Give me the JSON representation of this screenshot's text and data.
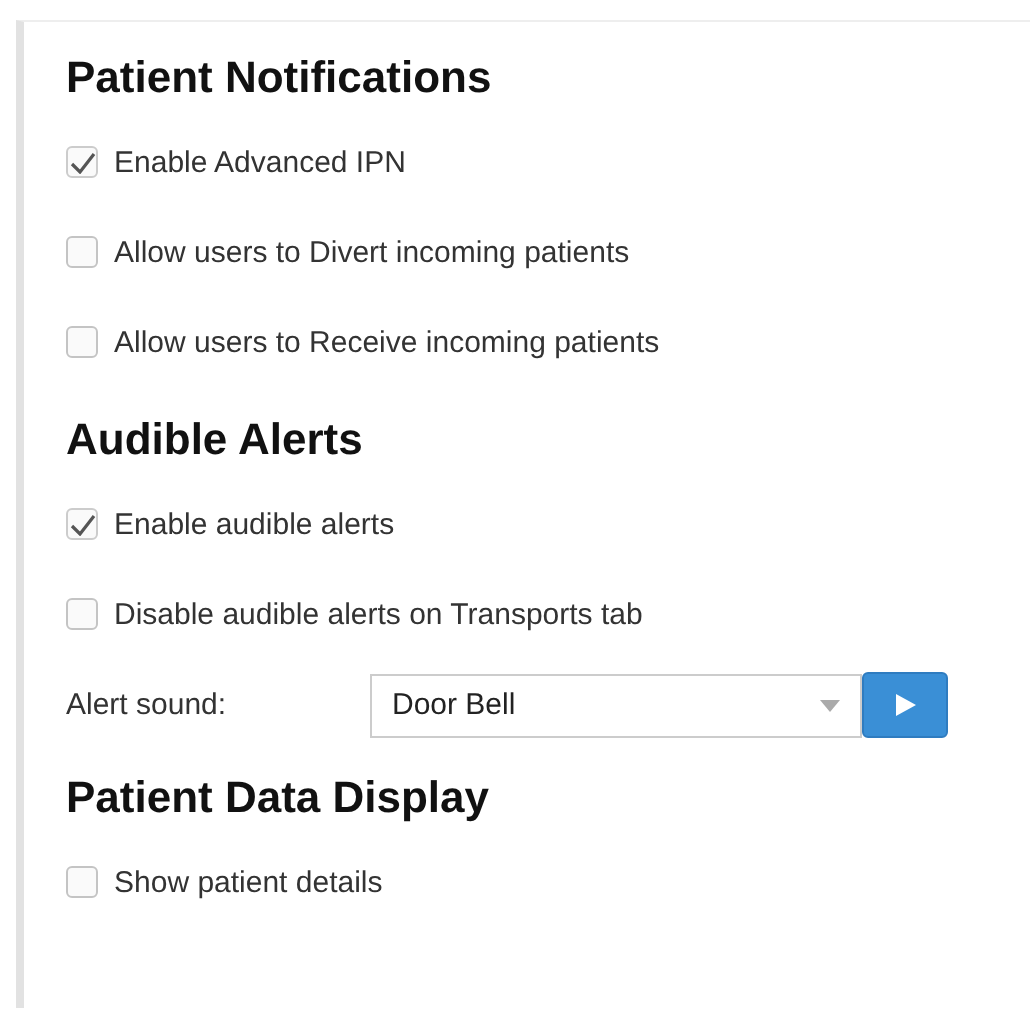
{
  "sections": [
    {
      "title": "Patient Notifications",
      "items": [
        {
          "kind": "checkbox",
          "label": "Enable Advanced IPN",
          "checked": true
        },
        {
          "kind": "checkbox",
          "label": "Allow users to Divert incoming patients",
          "checked": false
        },
        {
          "kind": "checkbox",
          "label": "Allow users to Receive incoming patients",
          "checked": false
        }
      ]
    },
    {
      "title": "Audible Alerts",
      "items": [
        {
          "kind": "checkbox",
          "label": "Enable audible alerts",
          "checked": true
        },
        {
          "kind": "checkbox",
          "label": "Disable audible alerts on Transports tab",
          "checked": false
        },
        {
          "kind": "select",
          "label": "Alert sound:",
          "value": "Door Bell"
        }
      ]
    },
    {
      "title": "Patient Data Display",
      "items": [
        {
          "kind": "checkbox",
          "label": "Show patient details",
          "checked": false
        }
      ]
    }
  ]
}
